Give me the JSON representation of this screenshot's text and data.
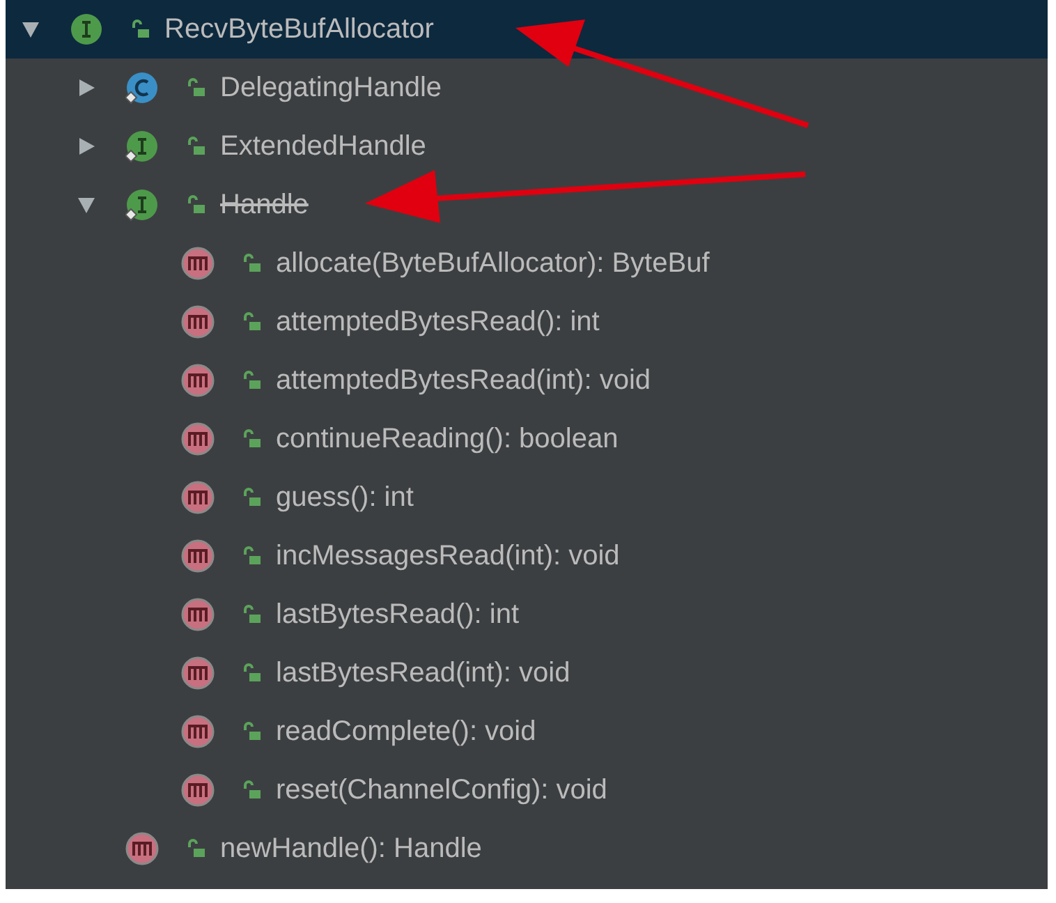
{
  "tree": [
    {
      "label": "RecvByteBufAllocator",
      "kind": "interface",
      "selected": true,
      "expanded": true,
      "deprecated": false,
      "children": [
        {
          "label": "DelegatingHandle",
          "kind": "class",
          "selected": false,
          "expanded": false,
          "deprecated": false
        },
        {
          "label": "ExtendedHandle",
          "kind": "interface",
          "selected": false,
          "expanded": false,
          "deprecated": false
        },
        {
          "label": "Handle",
          "kind": "interface",
          "selected": false,
          "expanded": true,
          "deprecated": true,
          "children": [
            {
              "label": "allocate(ByteBufAllocator): ByteBuf",
              "kind": "method",
              "selected": false,
              "deprecated": false
            },
            {
              "label": "attemptedBytesRead(): int",
              "kind": "method",
              "selected": false,
              "deprecated": false
            },
            {
              "label": "attemptedBytesRead(int): void",
              "kind": "method",
              "selected": false,
              "deprecated": false
            },
            {
              "label": "continueReading(): boolean",
              "kind": "method",
              "selected": false,
              "deprecated": false
            },
            {
              "label": "guess(): int",
              "kind": "method",
              "selected": false,
              "deprecated": false
            },
            {
              "label": "incMessagesRead(int): void",
              "kind": "method",
              "selected": false,
              "deprecated": false
            },
            {
              "label": "lastBytesRead(): int",
              "kind": "method",
              "selected": false,
              "deprecated": false
            },
            {
              "label": "lastBytesRead(int): void",
              "kind": "method",
              "selected": false,
              "deprecated": false
            },
            {
              "label": "readComplete(): void",
              "kind": "method",
              "selected": false,
              "deprecated": false
            },
            {
              "label": "reset(ChannelConfig): void",
              "kind": "method",
              "selected": false,
              "deprecated": false
            }
          ]
        },
        {
          "label": "newHandle(): Handle",
          "kind": "method",
          "selected": false,
          "deprecated": false
        }
      ]
    }
  ]
}
